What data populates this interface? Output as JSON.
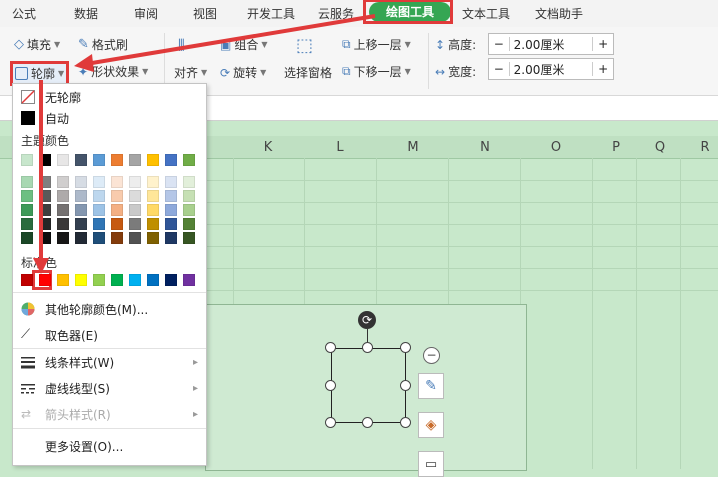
{
  "tabs": {
    "formula": "公式",
    "data": "数据",
    "review": "审阅",
    "view": "视图",
    "dev": "开发工具",
    "cloud": "云服务",
    "draw": "绘图工具",
    "text": "文本工具",
    "dochelper": "文档助手"
  },
  "ribbon": {
    "fill": "填充",
    "format_painter": "格式刷",
    "outline": "轮廓",
    "shape_effect": "形状效果",
    "align": "对齐",
    "group": "组合",
    "rotate": "旋转",
    "selection_pane": "选择窗格",
    "bring_forward": "上移一层",
    "send_backward": "下移一层",
    "height_label": "高度:",
    "height_value": "2.00厘米",
    "width_label": "宽度:",
    "width_value": "2.00厘米",
    "minus": "−",
    "plus": "+"
  },
  "columns": [
    "K",
    "L",
    "M",
    "N",
    "O",
    "P",
    "Q",
    "R"
  ],
  "menu": {
    "no_outline": "无轮廓",
    "auto": "自动",
    "theme_colors": "主题颜色",
    "standard_colors": "标准色",
    "more_colors": "其他轮廓颜色(M)...",
    "eyedropper": "取色器(E)",
    "line_style": "线条样式(W)",
    "dash_style": "虚线线型(S)",
    "arrow_style": "箭头样式(R)",
    "more_settings": "更多设置(O)...",
    "theme_row": [
      "#c7e6cc",
      "#000000",
      "#e7e6e6",
      "#44546a",
      "#5b9bd5",
      "#ed7d31",
      "#a5a5a5",
      "#ffc000",
      "#4472c4",
      "#70ad47"
    ],
    "theme_grid": [
      [
        "#a8d8b2",
        "#7f7f7f",
        "#d0cece",
        "#d6dce4",
        "#ddebf7",
        "#fbe4d5",
        "#ededed",
        "#fff2cc",
        "#dae3f3",
        "#e2efda"
      ],
      [
        "#6dbf82",
        "#595959",
        "#aeaaaa",
        "#adb9ca",
        "#bdd7ee",
        "#f8cbad",
        "#dbdbdb",
        "#ffe699",
        "#b4c6e7",
        "#c6e0b4"
      ],
      [
        "#3e9a58",
        "#3f3f3f",
        "#757171",
        "#8497b0",
        "#9dc3e6",
        "#f4b084",
        "#c9c9c9",
        "#ffd966",
        "#8ea9db",
        "#a9d08e"
      ],
      [
        "#2a6b3d",
        "#262626",
        "#3a3838",
        "#333f4f",
        "#2f75b5",
        "#c65911",
        "#7b7b7b",
        "#bf8f00",
        "#2f5597",
        "#548235"
      ],
      [
        "#1b4727",
        "#0d0d0d",
        "#171616",
        "#222a35",
        "#1f4e79",
        "#843c0c",
        "#525252",
        "#7f6000",
        "#1f3864",
        "#375623"
      ]
    ],
    "standard_row": [
      "#c00000",
      "#ff0000",
      "#ffc000",
      "#ffff00",
      "#92d050",
      "#00b050",
      "#00b0f0",
      "#0070c0",
      "#002060",
      "#7030a0"
    ]
  },
  "colors": {
    "accent_green": "#35a653",
    "highlight_red": "#e03a3a",
    "sheet_green": "#c8e8cb"
  }
}
